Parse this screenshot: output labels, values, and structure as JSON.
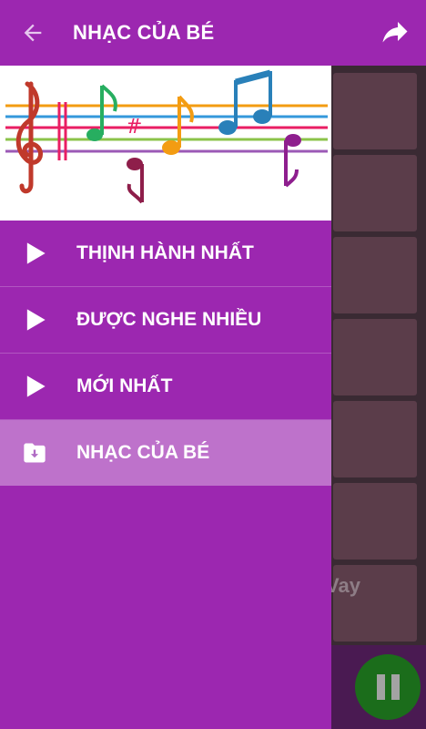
{
  "appbar": {
    "title": "NHẠC CỦA BÉ",
    "back_icon": "arrow-back-icon",
    "share_icon": "share-arrow-icon",
    "color": "#9c27b0"
  },
  "drawer": {
    "header_image": "music-notes-staff-image",
    "items": [
      {
        "label": "THỊNH HÀNH NHẤT",
        "icon": "play-icon",
        "active": false
      },
      {
        "label": "ĐƯỢC NGHE NHIỀU",
        "icon": "play-icon",
        "active": false
      },
      {
        "label": "MỚI NHẤT",
        "icon": "play-icon",
        "active": false
      },
      {
        "label": "NHẠC CỦA BÉ",
        "icon": "folder-download-icon",
        "active": true
      }
    ]
  },
  "background": {
    "caption_fragment": "Vay",
    "pause_icon": "pause-icon"
  }
}
